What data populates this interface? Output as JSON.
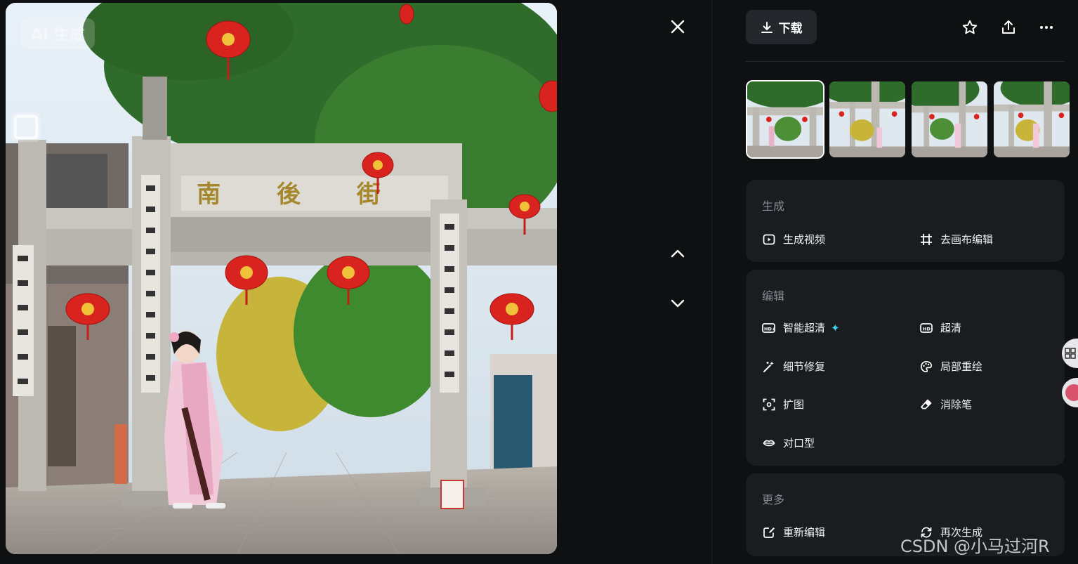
{
  "image_overlay": {
    "badge_text": "AI 生成",
    "arch_inscription": "南 後 街"
  },
  "toolbar": {
    "download_label": "下载"
  },
  "thumbnails": [
    {
      "selected": true
    },
    {
      "selected": false
    },
    {
      "selected": false
    },
    {
      "selected": false
    }
  ],
  "sections": {
    "generate": {
      "title": "生成",
      "actions": [
        "生成视频",
        "去画布编辑"
      ]
    },
    "edit": {
      "title": "编辑",
      "actions": [
        "智能超清",
        "超清",
        "细节修复",
        "局部重绘",
        "扩图",
        "消除笔",
        "对口型"
      ]
    },
    "more": {
      "title": "更多",
      "actions": [
        "重新编辑",
        "再次生成"
      ]
    }
  },
  "watermark": "CSDN @小马过河R",
  "colors": {
    "background": "#0f1012",
    "card": "#1b1c20",
    "button": "#25262b",
    "accent_sparkle": "#35d6f0",
    "lantern": "#d8231e"
  },
  "icons": {
    "close": "close-icon",
    "prev": "chevron-up-icon",
    "next": "chevron-down-icon",
    "download": "download-icon",
    "favorite": "star-icon",
    "share": "share-icon",
    "more": "more-dots-icon"
  }
}
